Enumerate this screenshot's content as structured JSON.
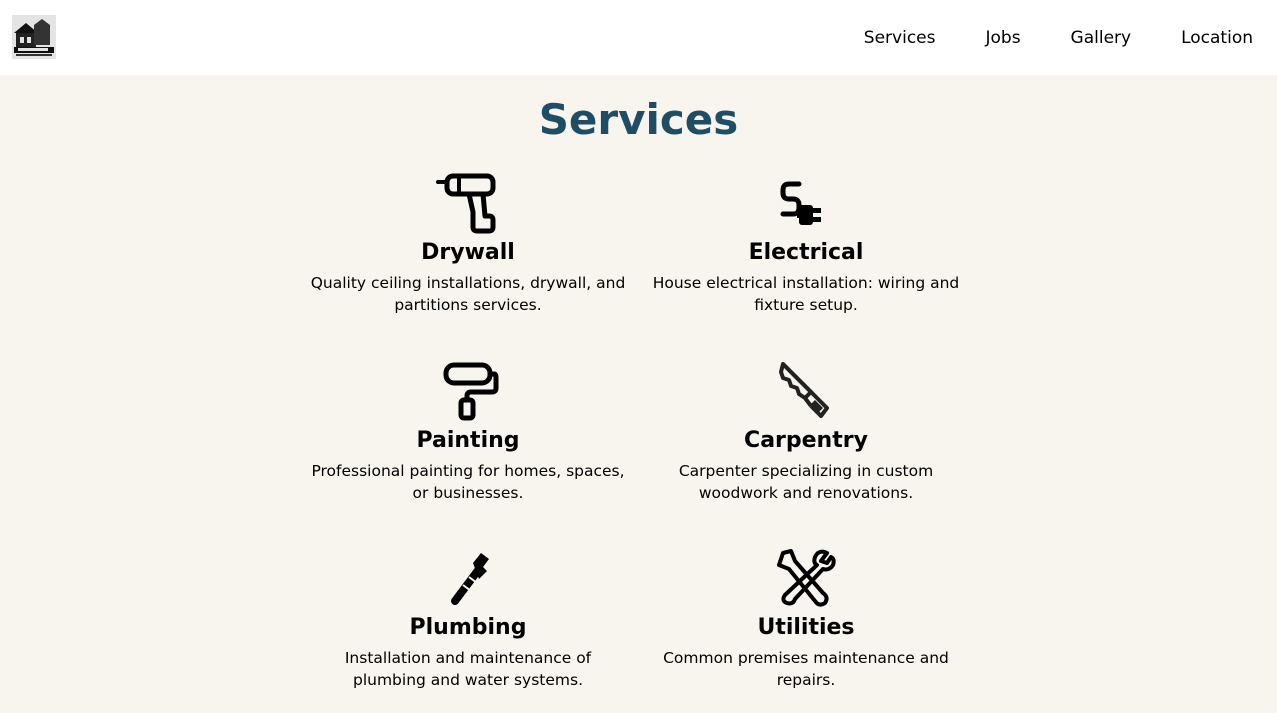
{
  "header": {
    "logo_icon": "company-logo",
    "nav": [
      {
        "label": "Services"
      },
      {
        "label": "Jobs"
      },
      {
        "label": "Gallery"
      },
      {
        "label": "Location"
      }
    ]
  },
  "main": {
    "title": "Services",
    "title_color": "#1d4e66",
    "background": "#f8f4ee",
    "services": [
      {
        "icon": "drill-icon",
        "title": "Drywall",
        "description": "Quality ceiling installations, drywall, and partitions services."
      },
      {
        "icon": "plug-icon",
        "title": "Electrical",
        "description": "House electrical installation: wiring and fixture setup."
      },
      {
        "icon": "paint-roller-icon",
        "title": "Painting",
        "description": "Professional painting for homes, spaces, or businesses."
      },
      {
        "icon": "saw-icon",
        "title": "Carpentry",
        "description": "Carpenter specializing in custom woodwork and renovations."
      },
      {
        "icon": "pipe-wrench-icon",
        "title": "Plumbing",
        "description": "Installation and maintenance of plumbing and water systems."
      },
      {
        "icon": "tools-icon",
        "title": "Utilities",
        "description": "Common premises maintenance and repairs."
      }
    ]
  }
}
